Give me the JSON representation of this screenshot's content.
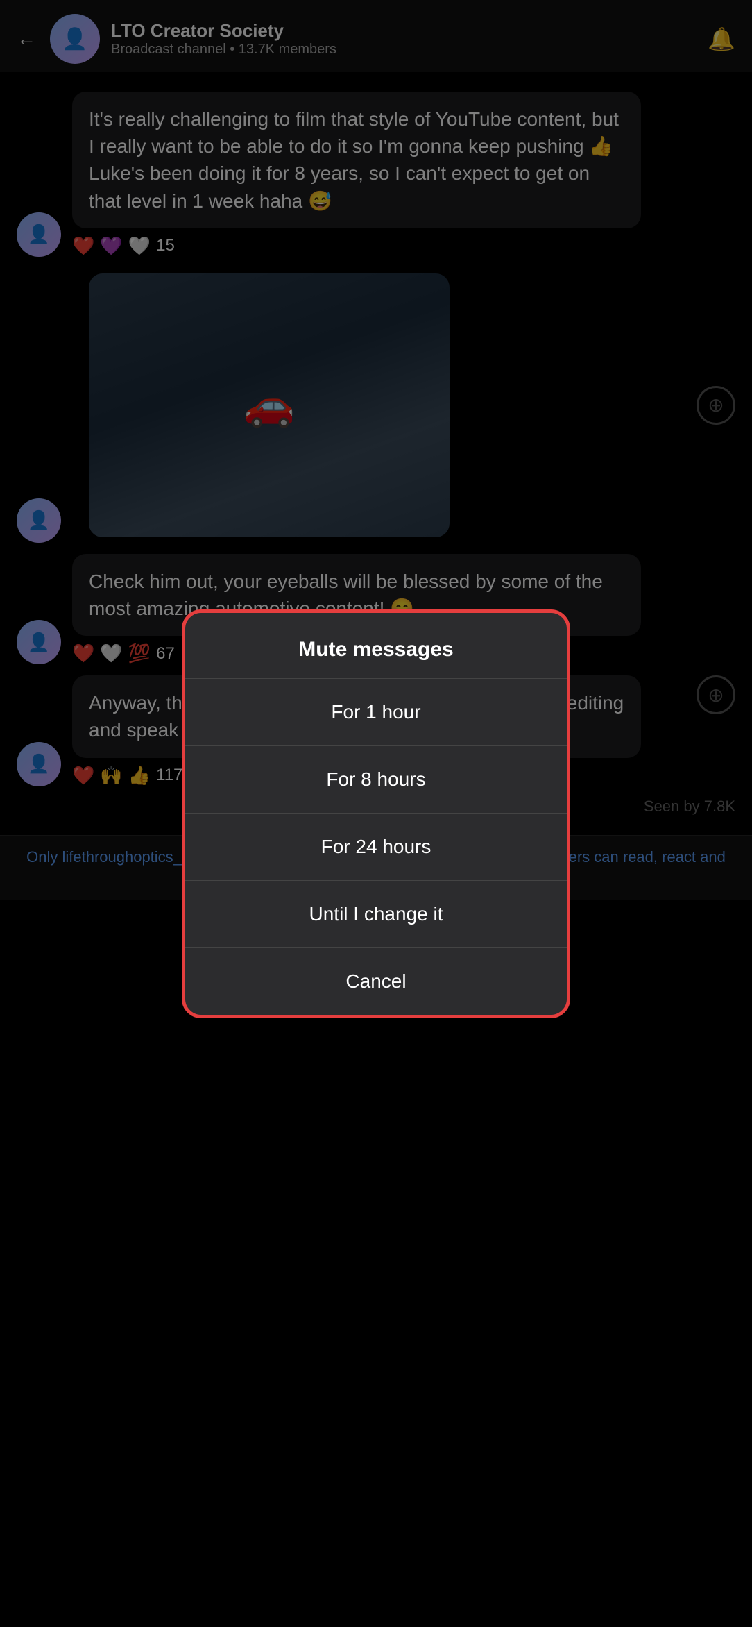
{
  "header": {
    "back_label": "←",
    "title": "LTO Creator Society",
    "subtitle": "Broadcast channel • 13.7K members",
    "bell_icon": "🔔"
  },
  "messages": [
    {
      "id": "msg1",
      "text": "It's really challenging to film that style of YouTube content, but I really want to be able to do it so I'm gonna keep pushing 👍 Luke's been doing it for 8 years, so I can't expect to get on that level in 1 week haha 😅",
      "reactions": [
        "❤️",
        "💜",
        "🤍"
      ],
      "reaction_count": "15",
      "has_avatar": true
    },
    {
      "id": "msg2",
      "text": "Check him out, your eyeballs will be blessed by some of the most amazing automotive content! 😊",
      "reactions": [
        "❤️",
        "🤍",
        "💯"
      ],
      "reaction_count": "67",
      "has_avatar": true
    },
    {
      "id": "msg3",
      "text": "Anyway, there's a full update from me! I'm gonna get to editing and speak to you all soon 🧡 let's keep pushing! 📈",
      "reactions": [
        "❤️",
        "🙌",
        "👍"
      ],
      "reaction_count": "117",
      "has_avatar": true
    }
  ],
  "seen_by": "Seen by 7.8K",
  "bottom_bar": {
    "text_before": "Only lifethroughoptics_",
    "verified_icon": "✓",
    "text_after": " and selected members can send messages. All members can read, react and vote in polls."
  },
  "modal": {
    "title": "Mute messages",
    "items": [
      {
        "id": "mute-1hour",
        "label": "For 1 hour"
      },
      {
        "id": "mute-8hours",
        "label": "For 8 hours"
      },
      {
        "id": "mute-24hours",
        "label": "For 24 hours"
      },
      {
        "id": "mute-until-change",
        "label": "Until I change it"
      },
      {
        "id": "cancel",
        "label": "Cancel"
      }
    ]
  }
}
